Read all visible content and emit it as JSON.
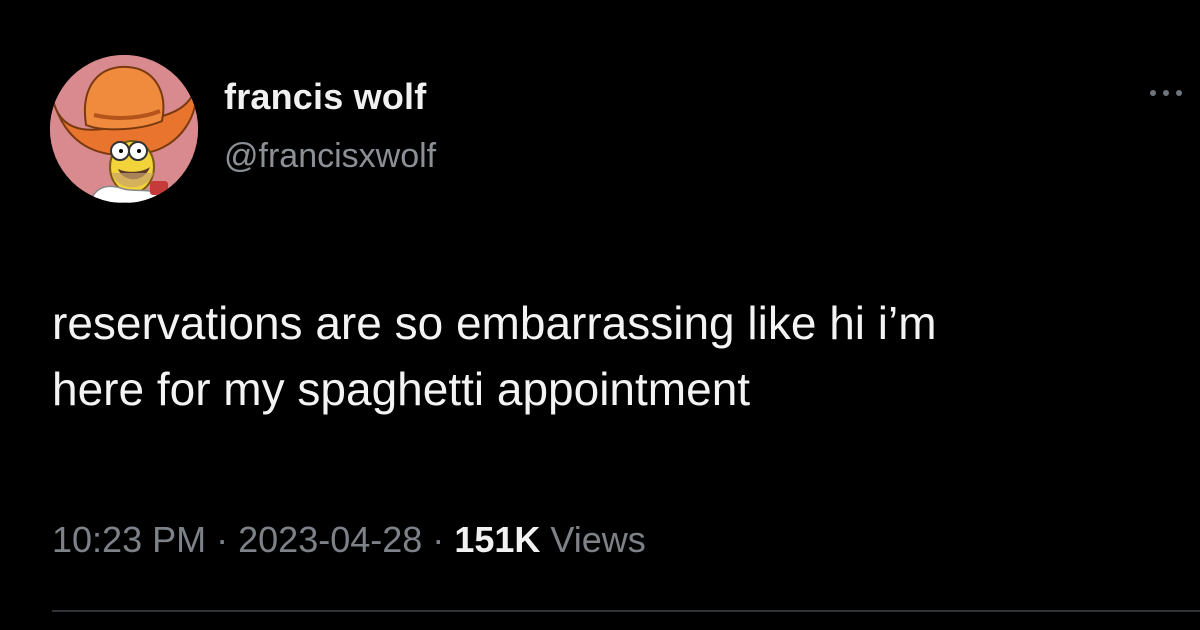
{
  "author": {
    "display_name": "francis wolf",
    "handle": "@francisxwolf",
    "avatar_icon": "homer-cowboy-hat-avatar"
  },
  "tweet": {
    "text_lines": [
      "reservations are so embarrassing like hi i’m",
      "here for my spaghetti appointment"
    ],
    "time": "10:23 PM",
    "separator": "·",
    "date": "2023-04-28",
    "views_count": "151K",
    "views_label": "Views"
  },
  "more_icon": "more-dots-icon",
  "colors": {
    "background": "#000000",
    "primary_text": "#f1f1f1",
    "secondary_text": "#7c8288",
    "avatar_bg": "#d98a8f",
    "hat": "#e8742e"
  }
}
